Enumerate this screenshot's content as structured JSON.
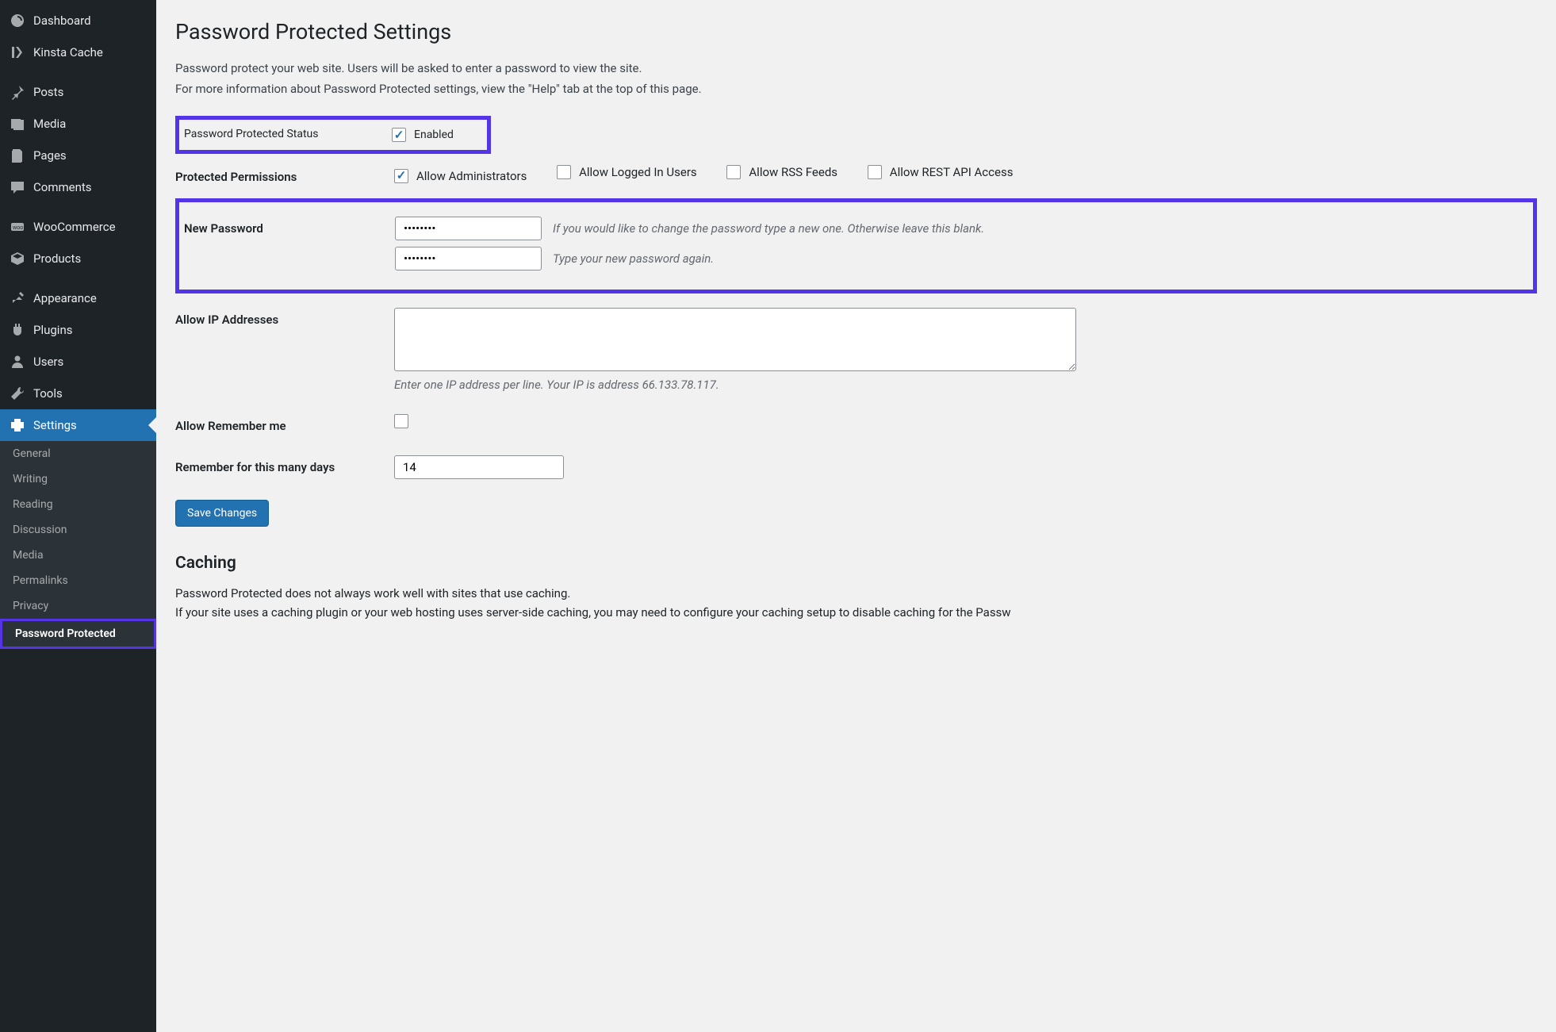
{
  "sidebar": {
    "items": [
      {
        "icon": "dashboard",
        "label": "Dashboard"
      },
      {
        "icon": "kinsta",
        "label": "Kinsta Cache"
      },
      {
        "icon": "pin",
        "label": "Posts"
      },
      {
        "icon": "media",
        "label": "Media"
      },
      {
        "icon": "pages",
        "label": "Pages"
      },
      {
        "icon": "comments",
        "label": "Comments"
      },
      {
        "icon": "woo",
        "label": "WooCommerce"
      },
      {
        "icon": "products",
        "label": "Products"
      },
      {
        "icon": "appearance",
        "label": "Appearance"
      },
      {
        "icon": "plugins",
        "label": "Plugins"
      },
      {
        "icon": "users",
        "label": "Users"
      },
      {
        "icon": "tools",
        "label": "Tools"
      },
      {
        "icon": "settings",
        "label": "Settings"
      }
    ],
    "submenu": [
      "General",
      "Writing",
      "Reading",
      "Discussion",
      "Media",
      "Permalinks",
      "Privacy",
      "Password Protected"
    ]
  },
  "page": {
    "title": "Password Protected Settings",
    "desc1": "Password protect your web site. Users will be asked to enter a password to view the site.",
    "desc2": "For more information about Password Protected settings, view the \"Help\" tab at the top of this page.",
    "status_label": "Password Protected Status",
    "enabled_label": "Enabled",
    "perm_label": "Protected Permissions",
    "perm_admin": "Allow Administrators",
    "perm_logged": "Allow Logged In Users",
    "perm_rss": "Allow RSS Feeds",
    "perm_rest": "Allow REST API Access",
    "newpw_label": "New Password",
    "pw_value": "••••••••",
    "pw_hint1": "If you would like to change the password type a new one. Otherwise leave this blank.",
    "pw_hint2": "Type your new password again.",
    "ip_label": "Allow IP Addresses",
    "ip_hint": "Enter one IP address per line. Your IP is address 66.133.78.117.",
    "remember_label": "Allow Remember me",
    "days_label": "Remember for this many days",
    "days_value": "14",
    "save_label": "Save Changes",
    "caching_title": "Caching",
    "caching_p1": "Password Protected does not always work well with sites that use caching.",
    "caching_p2": "If your site uses a caching plugin or your web hosting uses server-side caching, you may need to configure your caching setup to disable caching for the Passw"
  }
}
